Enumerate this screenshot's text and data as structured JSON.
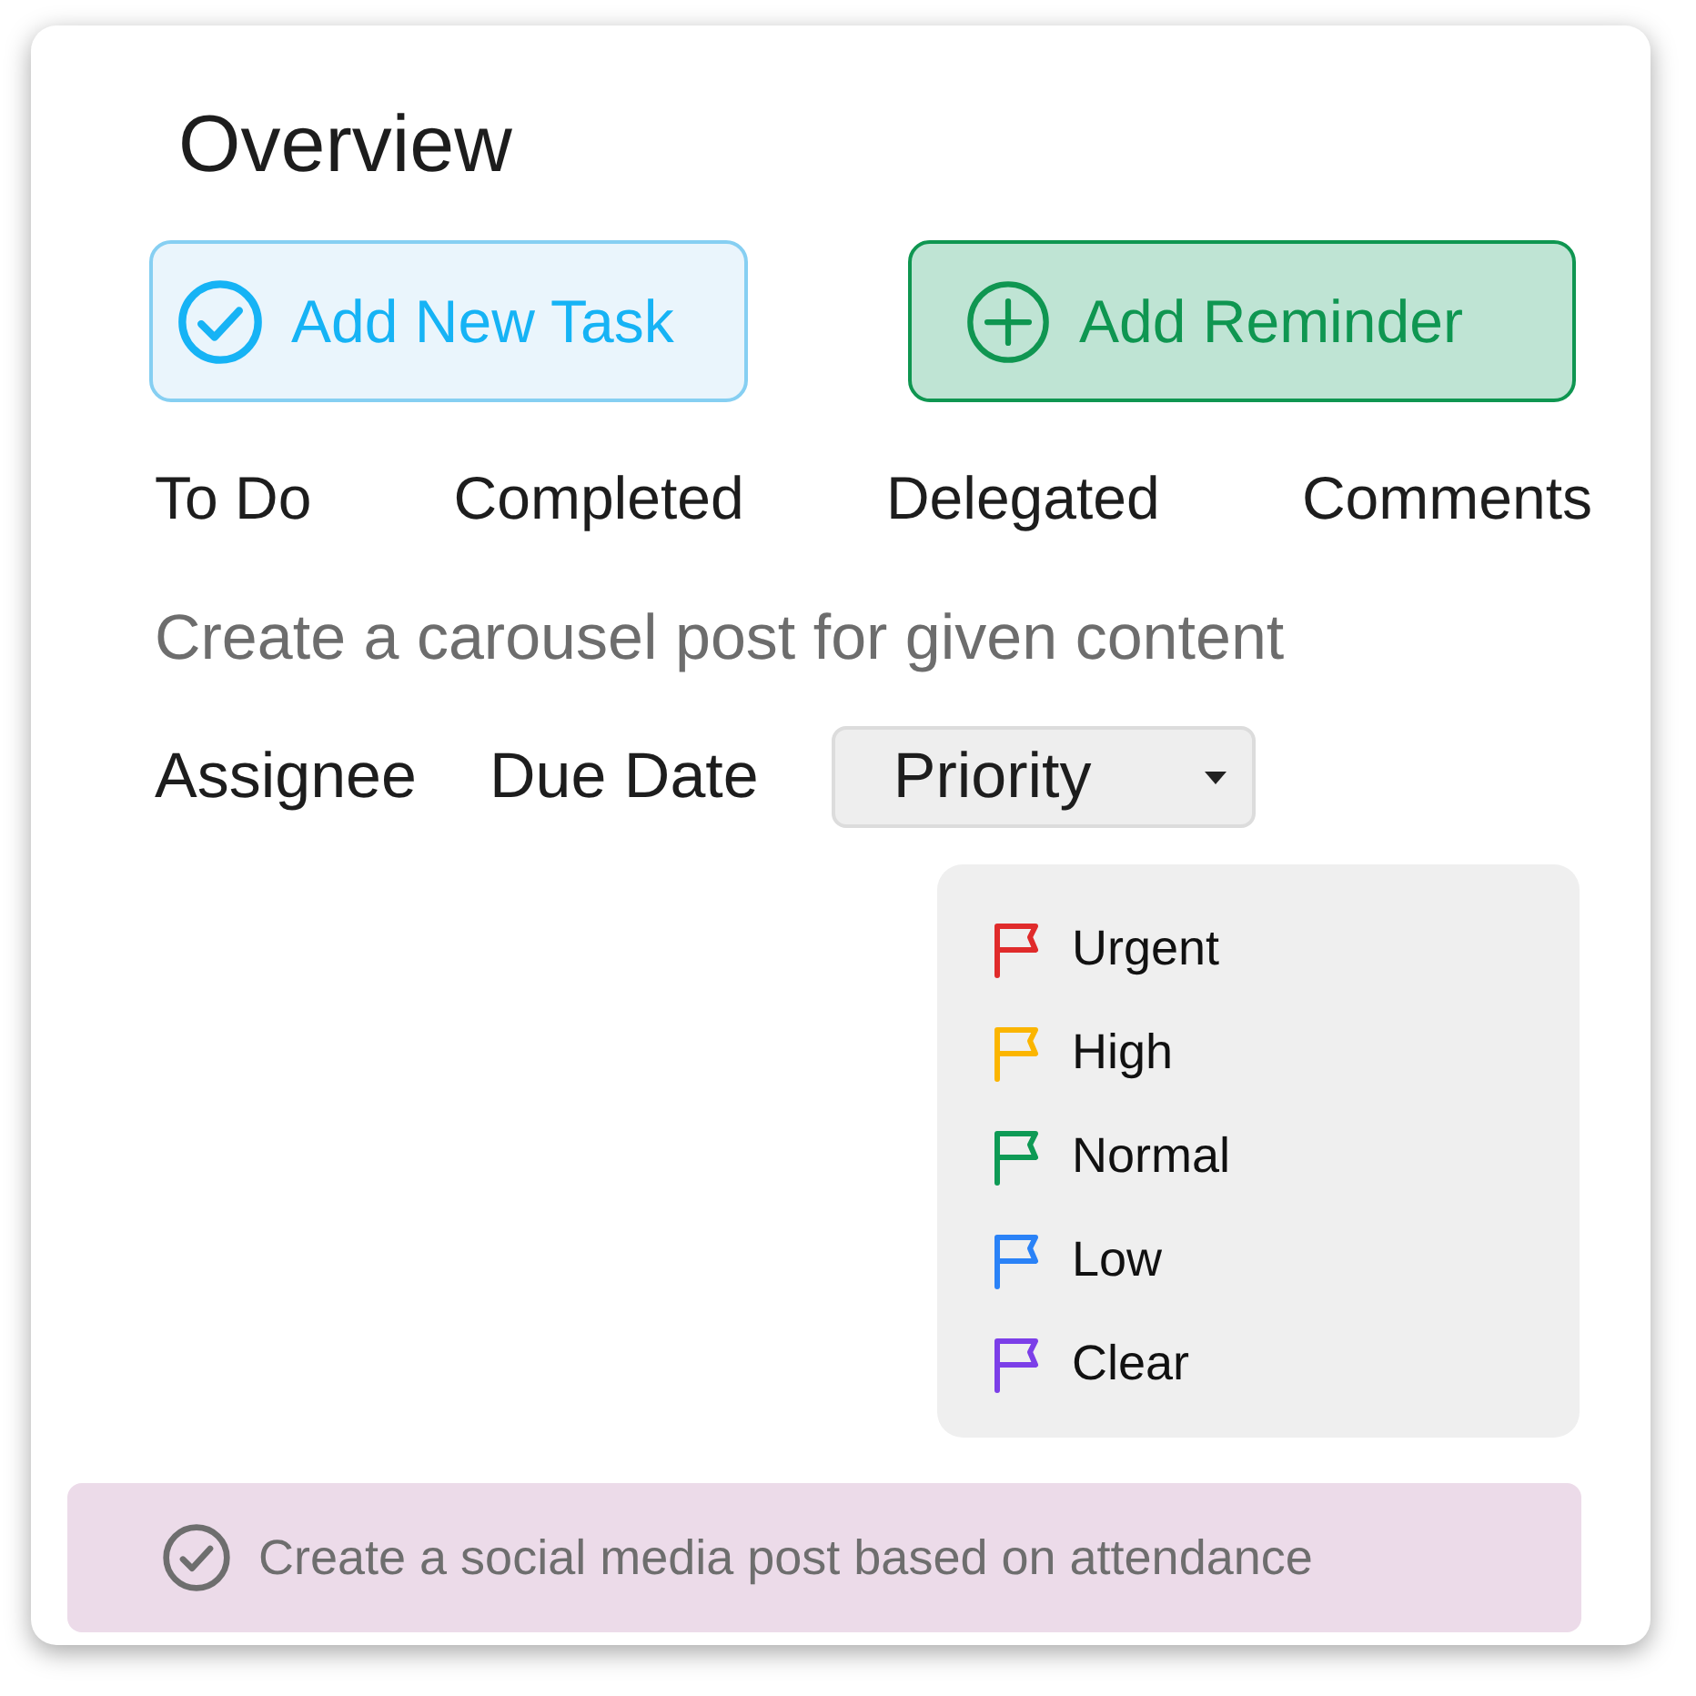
{
  "title": "Overview",
  "buttons": [
    {
      "label": "Add New Task",
      "kind": "check"
    },
    {
      "label": "Add Reminder",
      "kind": "plus"
    }
  ],
  "tabs": [
    "To Do",
    "Completed",
    "Delegated",
    "Comments"
  ],
  "task": "Create a carousel post for given content",
  "fields": [
    "Assignee",
    "Due Date"
  ],
  "priority_dropdown": {
    "label": "Priority",
    "expanded": true,
    "options": [
      {
        "label": "Urgent",
        "color": "#e02b2b"
      },
      {
        "label": "High",
        "color": "#fbb500"
      },
      {
        "label": "Normal",
        "color": "#0e9a55"
      },
      {
        "label": "Low",
        "color": "#2a82f7"
      },
      {
        "label": "Clear",
        "color": "#7c3fe8"
      }
    ]
  },
  "completed_task": "Create a social media post based on attendance"
}
